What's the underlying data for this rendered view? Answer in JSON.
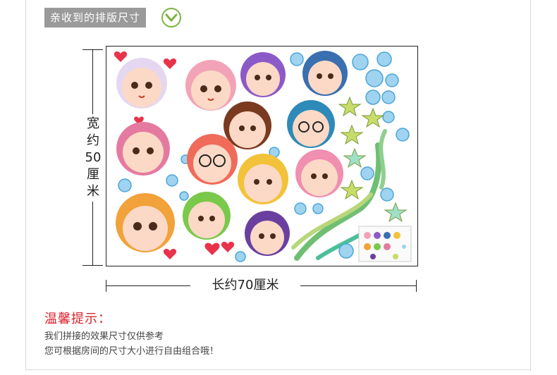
{
  "header": {
    "title": "亲收到的排版尺寸",
    "icon": "chevron-down-circle-icon",
    "accent": "#7cb342"
  },
  "dimensions": {
    "height_label": "宽约50厘米",
    "width_label": "长约70厘米"
  },
  "tips": {
    "title": "温馨提示：",
    "lines": [
      "我们拼接的效果尺寸仅供参考",
      "您可根据房间的尺寸大小进行自由组合哦！"
    ]
  },
  "colors": {
    "tip_title": "#d9232d",
    "header_bg": "#9a9a9a",
    "border": "#222222"
  }
}
